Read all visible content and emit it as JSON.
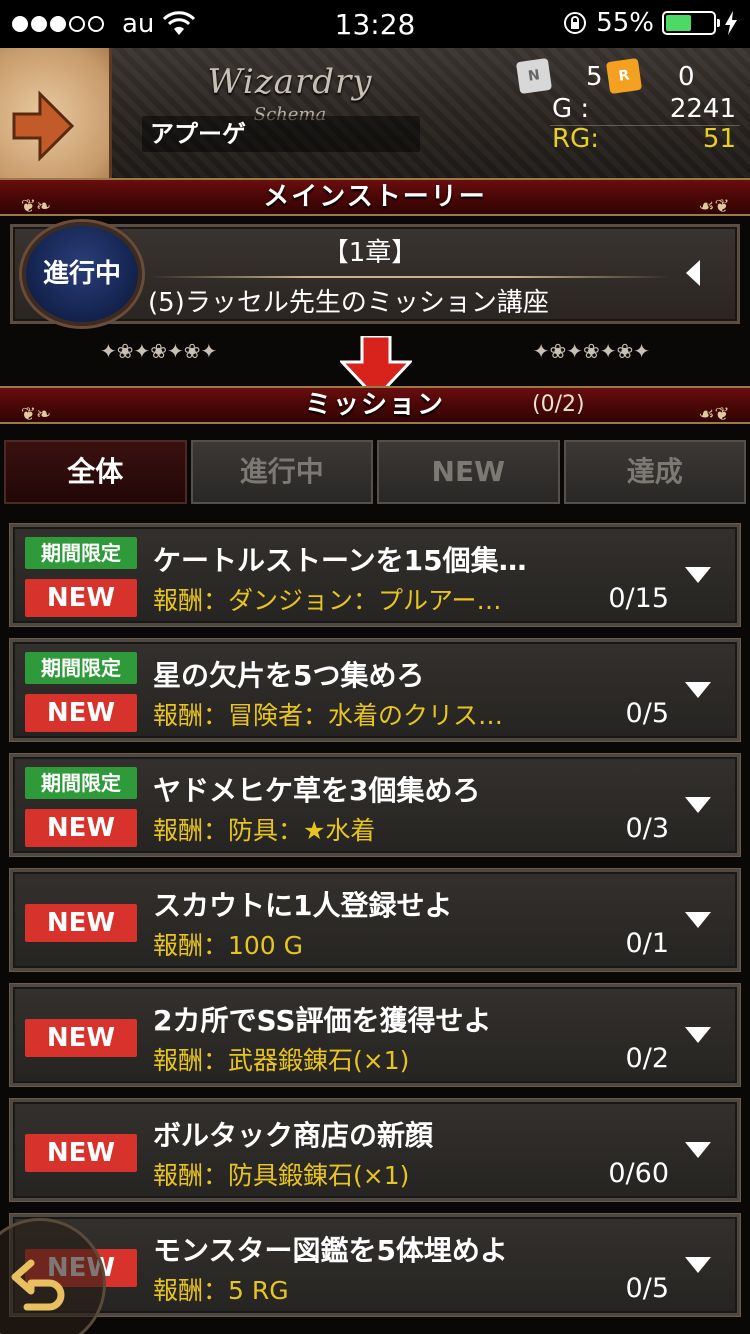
{
  "status_bar": {
    "carrier": "au",
    "time": "13:28",
    "battery": "55%",
    "battery_level": 0.55
  },
  "header": {
    "logo": "Wizardry",
    "logo_sub": "Schema",
    "player_name": "アプーゲ",
    "ticket_n_icon": "N",
    "ticket_n_count": "5",
    "ticket_r_icon": "R",
    "ticket_r_count": "0",
    "gold_label": "G :",
    "gold_value": "2241",
    "rg_label": "RG:",
    "rg_value": "51"
  },
  "main_story": {
    "banner": "メインストーリー",
    "status_badge": "進行中",
    "chapter": "【1章】",
    "title": "(5)ラッセル先生のミッション講座"
  },
  "mission_section": {
    "banner": "ミッション",
    "count": "(0/2)"
  },
  "tabs": [
    {
      "label": "全体",
      "active": true
    },
    {
      "label": "進行中",
      "active": false
    },
    {
      "label": "NEW",
      "active": false
    },
    {
      "label": "達成",
      "active": false
    }
  ],
  "missions": [
    {
      "limited": "期間限定",
      "new": "NEW",
      "title": "ケートルストーンを15個集…",
      "reward": "報酬：ダンジョン：プルアー…",
      "progress": "0/15"
    },
    {
      "limited": "期間限定",
      "new": "NEW",
      "title": "星の欠片を5つ集めろ",
      "reward": "報酬：冒険者：水着のクリス…",
      "progress": "0/5"
    },
    {
      "limited": "期間限定",
      "new": "NEW",
      "title": "ヤドメヒケ草を3個集めろ",
      "reward": "報酬：防具：★水着",
      "progress": "0/3"
    },
    {
      "limited": "",
      "new": "NEW",
      "title": "スカウトに1人登録せよ",
      "reward": "報酬：100 G",
      "progress": "0/1"
    },
    {
      "limited": "",
      "new": "NEW",
      "title": "2カ所でSS評価を獲得せよ",
      "reward": "報酬：武器鍛錬石(×1)",
      "progress": "0/2"
    },
    {
      "limited": "",
      "new": "NEW",
      "title": "ボルタック商店の新顔",
      "reward": "報酬：防具鍛錬石(×1)",
      "progress": "0/60"
    },
    {
      "limited": "",
      "new": "NEW",
      "title": "モンスター図鑑を5体埋めよ",
      "reward": "報酬：5 RG",
      "progress": "0/5"
    }
  ],
  "colors": {
    "accent_red": "#d8322c",
    "limited_green": "#2f9a3a",
    "reward_gold": "#e8c420",
    "banner_red": "#4a0707"
  }
}
